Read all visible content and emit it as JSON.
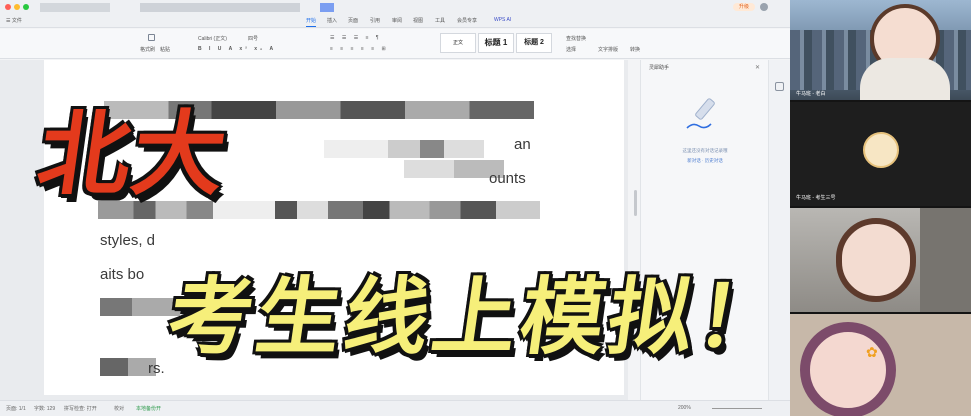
{
  "app": {
    "title": "WPS AI",
    "share_label": "分享",
    "login_label": "升级"
  },
  "ribbon_tabs": [
    "开始",
    "插入",
    "页面",
    "引用",
    "审阅",
    "视图",
    "工具",
    "会员专享"
  ],
  "ribbon": {
    "font_name": "Calibri (正文)",
    "font_size": "四号",
    "format_painter": "格式刷",
    "paste": "粘贴",
    "style_normal": "正文",
    "style_h1": "标题 1",
    "style_h2": "标题 2",
    "find_replace": "查找替换",
    "select": "选择",
    "text_layout": "文字排版",
    "convert": "转换"
  },
  "document": {
    "fragments": {
      "line1_end": "an",
      "line2_end": "ounts",
      "line4_start": "styles,  d",
      "line5_start": "aits bo",
      "line7_end": "rs."
    }
  },
  "side_pane": {
    "title": "灵犀助手",
    "empty_text": "这里还没有对话记录哦",
    "actions": "新对话 · 历史对话"
  },
  "status_bar": {
    "page": "页面: 1/1",
    "words": "字数: 129",
    "spellcheck": "拼写检查: 打开",
    "proofread": "校对",
    "unsaved": "本地备份开",
    "zoom": "200%"
  },
  "participants": [
    {
      "name": "牛马班 - 老白"
    },
    {
      "name": "牛马班 - 考生三号"
    },
    {
      "name": ""
    },
    {
      "name": ""
    }
  ],
  "overlay": {
    "headline": "北大",
    "subheadline": "考生线上模拟！"
  },
  "colors": {
    "accent": "#1f6feb",
    "headline": "#e33a1c",
    "subheadline": "#f6ef7a"
  }
}
